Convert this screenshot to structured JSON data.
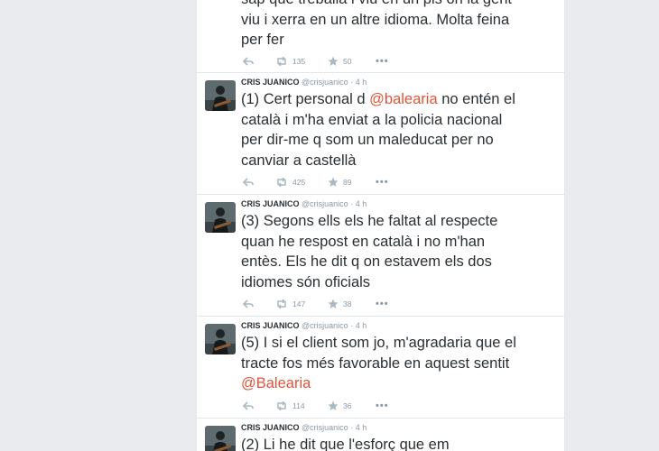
{
  "colors": {
    "mention": "#e0543a",
    "text": "#292f33",
    "meta": "#8899a6",
    "divider": "#e1e8ed"
  },
  "icons": {
    "reply": "reply-icon",
    "retweet": "retweet-icon",
    "favorite": "star-icon",
    "more": "more-icon"
  },
  "tweets": [
    {
      "name": "",
      "handle": "",
      "time": "",
      "body": [
        [
          {
            "t": "sap que treballa i viu en un pis on la gent"
          }
        ],
        [
          {
            "t": "viu i xerra en un altre idioma. Molta feina"
          }
        ],
        [
          {
            "t": "per fer"
          }
        ]
      ],
      "retweets": "135",
      "favorites": "50",
      "more": "•••"
    },
    {
      "name": "CRIS JUANICO",
      "handle": "@crisjuanico",
      "time": "4 h",
      "body": [
        [
          {
            "t": "(1) Cert personal d "
          },
          {
            "t": "@balearia",
            "m": true
          },
          {
            "t": " no entén el"
          }
        ],
        [
          {
            "t": "català i m'ha enviat a la policia nacional"
          }
        ],
        [
          {
            "t": "per dir-me q som un maleducat per no"
          }
        ],
        [
          {
            "t": "canviar a castellà"
          }
        ]
      ],
      "retweets": "425",
      "favorites": "89",
      "more": "•••"
    },
    {
      "name": "CRIS JUANICO",
      "handle": "@crisjuanico",
      "time": "4 h",
      "body": [
        [
          {
            "t": "(3) Segons ells els he faltat al respecte"
          }
        ],
        [
          {
            "t": "quan he respost en català i no m'han"
          }
        ],
        [
          {
            "t": "entès. Els he dit q on estavem els dos"
          }
        ],
        [
          {
            "t": "idiomes són oficials"
          }
        ]
      ],
      "retweets": "147",
      "favorites": "38",
      "more": "•••"
    },
    {
      "name": "CRIS JUANICO",
      "handle": "@crisjuanico",
      "time": "4 h",
      "body": [
        [
          {
            "t": "(5) I si el client som jo, m'agradaria que el"
          }
        ],
        [
          {
            "t": "tracte fos més favorable en aquest sentit"
          }
        ],
        [
          {
            "t": "@Balearia",
            "m": true
          }
        ]
      ],
      "retweets": "114",
      "favorites": "36",
      "more": "•••"
    },
    {
      "name": "CRIS JUANICO",
      "handle": "@crisjuanico",
      "time": "4 h",
      "body": [
        [
          {
            "t": "(2) Li he dit que l'esforç que em"
          }
        ]
      ],
      "retweets": "",
      "favorites": "",
      "more": ""
    }
  ]
}
